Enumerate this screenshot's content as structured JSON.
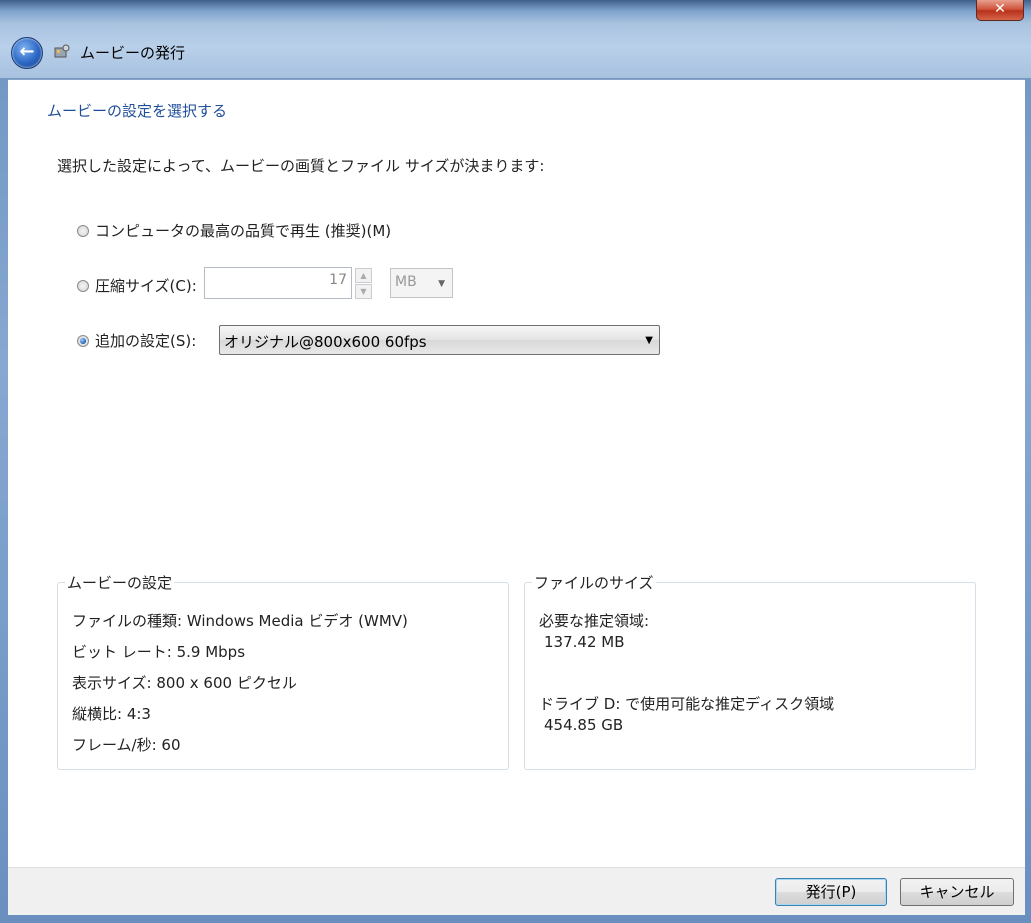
{
  "window": {
    "title": "ムービーの発行",
    "close_label": "✕"
  },
  "page": {
    "heading": "ムービーの設定を選択する",
    "description": "選択した設定によって、ムービーの画質とファイル サイズが決まります:"
  },
  "options": {
    "best_quality_label": "コンピュータの最高の品質で再生 (推奨)(M)",
    "compressed_label": "圧縮サイズ(C):",
    "compressed_value": "17",
    "compressed_unit": "MB",
    "advanced_label": "追加の設定(S):",
    "advanced_value": "オリジナル@800x600 60fps",
    "selected": "advanced"
  },
  "movie_settings": {
    "title": "ムービーの設定",
    "file_type": "ファイルの種類: Windows Media ビデオ (WMV)",
    "bit_rate": "ビット レート: 5.9 Mbps",
    "display_size": "表示サイズ: 800 x 600 ピクセル",
    "aspect_ratio": "縦横比: 4:3",
    "frame_rate": "フレーム/秒: 60"
  },
  "file_size": {
    "title": "ファイルのサイズ",
    "required_label": "必要な推定領域:",
    "required_value": "137.42 MB",
    "available_label": "ドライブ D: で使用可能な推定ディスク領域",
    "available_value": "454.85 GB"
  },
  "buttons": {
    "publish": "発行(P)",
    "cancel": "キャンセル"
  },
  "colors": {
    "heading": "#1f4e9a",
    "titlebar": "#a9c2df"
  }
}
